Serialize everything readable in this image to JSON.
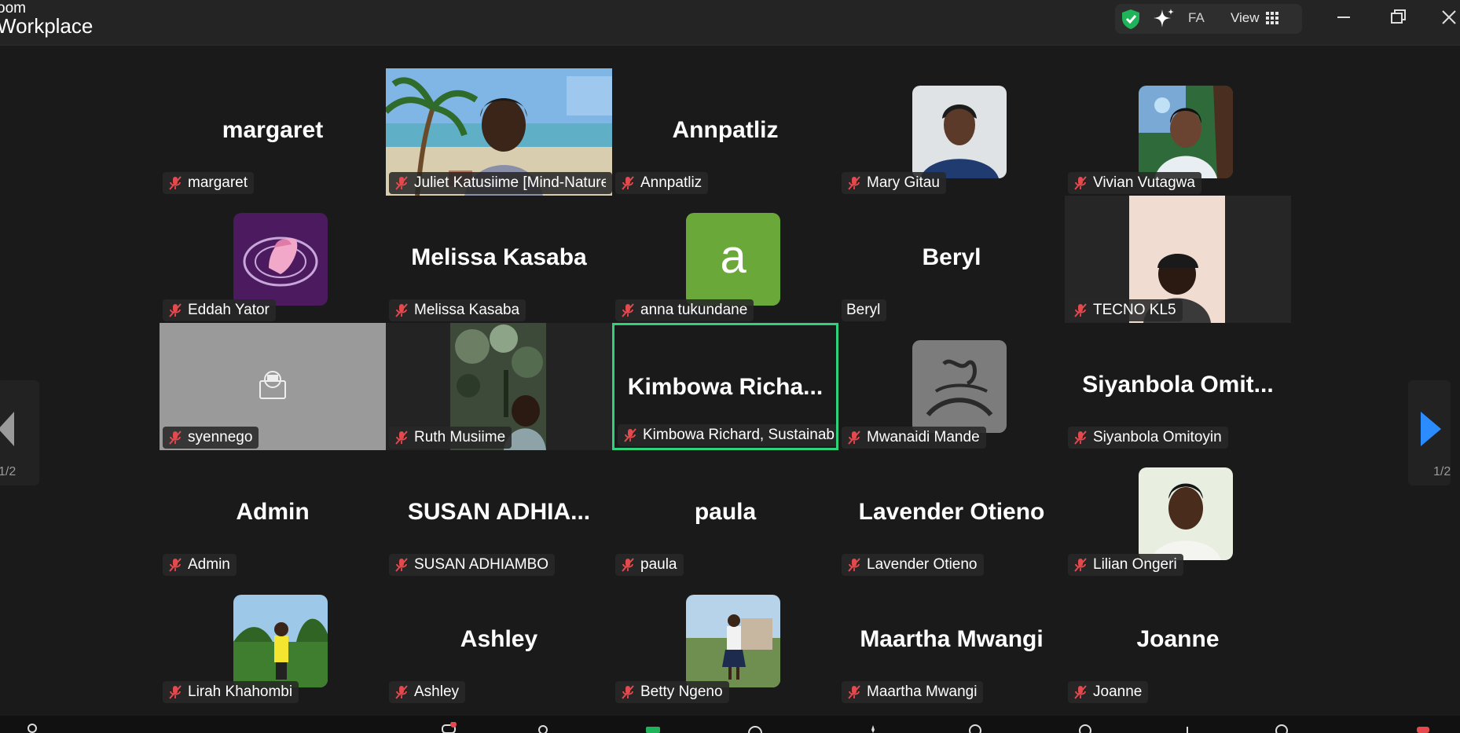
{
  "app": {
    "title_line1": "oom",
    "title_line2": "Workplace"
  },
  "titlebar": {
    "language_label": "FA",
    "view_label": "View",
    "icons": [
      "shield-check-icon",
      "ai-sparkle-icon",
      "grid-icon",
      "minimize-icon",
      "restore-icon",
      "close-icon"
    ],
    "accent_colors": {
      "shield": "#1fb35a",
      "active_speaker": "#2fd27a",
      "muted_mic": "#e5484d"
    }
  },
  "gallery": {
    "page_indicator_left": "1/2",
    "page_indicator_right": "1/2",
    "tiles": [
      {
        "name": "margaret",
        "display": "margaret",
        "kind": "text"
      },
      {
        "name": "Juliet Katusiime [Mind-Nature I...",
        "display": "",
        "kind": "video",
        "video": "beach"
      },
      {
        "name": "Annpatliz",
        "display": "Annpatliz",
        "kind": "text"
      },
      {
        "name": "Mary Gitau",
        "display": "",
        "kind": "avatar",
        "avatar": "blue"
      },
      {
        "name": "Vivian Vutagwa",
        "display": "",
        "kind": "avatar",
        "avatar": "outdoor"
      },
      {
        "name": "Eddah Yator",
        "display": "",
        "kind": "avatar",
        "avatar": "purple"
      },
      {
        "name": "Melissa Kasaba",
        "display": "Melissa Kasaba",
        "kind": "text"
      },
      {
        "name": "anna tukundane",
        "display": "a",
        "kind": "letter",
        "letter_bg": "#6aa83a"
      },
      {
        "name": "Beryl",
        "display": "Beryl",
        "kind": "text",
        "unmuted": true
      },
      {
        "name": "TECNO KL5",
        "display": "",
        "kind": "video",
        "video": "phone"
      },
      {
        "name": "syennego",
        "display": "",
        "kind": "video",
        "video": "camera-off"
      },
      {
        "name": "Ruth Musiime",
        "display": "",
        "kind": "video",
        "video": "trees"
      },
      {
        "name": "Kimbowa Richard, Sustainabilit...",
        "display": "Kimbowa  Richa...",
        "kind": "text",
        "active": true
      },
      {
        "name": "Mwanaidi Mande",
        "display": "",
        "kind": "avatar",
        "avatar": "sign"
      },
      {
        "name": "Siyanbola Omitoyin",
        "display": "Siyanbola  Omit...",
        "kind": "text"
      },
      {
        "name": "Admin",
        "display": "Admin",
        "kind": "text"
      },
      {
        "name": "SUSAN ADHIAMBO",
        "display": "SUSAN  ADHIA...",
        "kind": "text"
      },
      {
        "name": "paula",
        "display": "paula",
        "kind": "text"
      },
      {
        "name": "Lavender Otieno",
        "display": "Lavender Otieno",
        "kind": "text"
      },
      {
        "name": "Lilian Ongeri",
        "display": "",
        "kind": "avatar",
        "avatar": "portrait"
      },
      {
        "name": "Lirah Khahombi",
        "display": "",
        "kind": "avatar",
        "avatar": "garden"
      },
      {
        "name": "Ashley",
        "display": "Ashley",
        "kind": "text"
      },
      {
        "name": "Betty Ngeno",
        "display": "",
        "kind": "avatar",
        "avatar": "standing"
      },
      {
        "name": "Maartha Mwangi",
        "display": "Maartha Mwangi",
        "kind": "text"
      },
      {
        "name": "Joanne",
        "display": "Joanne",
        "kind": "text"
      }
    ]
  }
}
